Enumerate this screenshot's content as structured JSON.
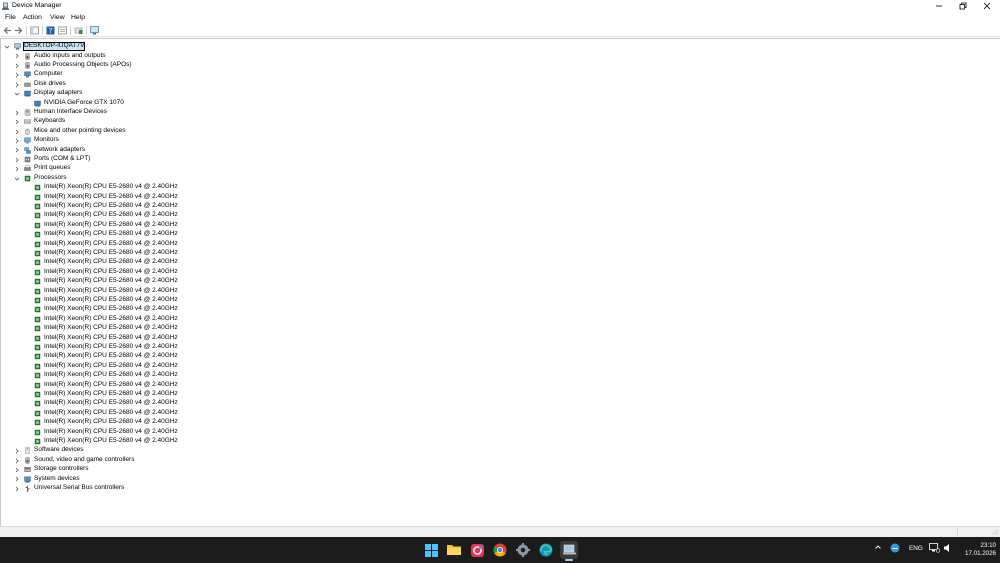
{
  "window": {
    "title": "Device Manager",
    "controls": {
      "minimize": "—",
      "restore": "❐",
      "close": "✕"
    }
  },
  "menu": [
    "File",
    "Action",
    "View",
    "Help"
  ],
  "tree": {
    "root": "DESKTOP-IUQAT7V",
    "categories": [
      {
        "label": "Audio inputs and outputs",
        "icon": "speaker-icon",
        "expanded": false
      },
      {
        "label": "Audio Processing Objects (APOs)",
        "icon": "speaker-icon",
        "expanded": false
      },
      {
        "label": "Computer",
        "icon": "computer-icon",
        "expanded": false
      },
      {
        "label": "Disk drives",
        "icon": "disk-drive-icon",
        "expanded": false
      },
      {
        "label": "Display adapters",
        "icon": "display-adapter-icon",
        "expanded": true,
        "children": [
          "NVIDIA GeForce GTX 1070"
        ]
      },
      {
        "label": "Human Interface Devices",
        "icon": "hid-icon",
        "expanded": false
      },
      {
        "label": "Keyboards",
        "icon": "keyboard-icon",
        "expanded": false
      },
      {
        "label": "Mice and other pointing devices",
        "icon": "mouse-icon",
        "expanded": false
      },
      {
        "label": "Monitors",
        "icon": "monitor-icon",
        "expanded": false
      },
      {
        "label": "Network adapters",
        "icon": "network-icon",
        "expanded": false
      },
      {
        "label": "Ports (COM & LPT)",
        "icon": "port-icon",
        "expanded": false
      },
      {
        "label": "Print queues",
        "icon": "printer-icon",
        "expanded": false
      },
      {
        "label": "Processors",
        "icon": "processor-icon",
        "expanded": true,
        "children": [
          "Intel(R) Xeon(R) CPU E5-2680 v4 @ 2.40GHz",
          "Intel(R) Xeon(R) CPU E5-2680 v4 @ 2.40GHz",
          "Intel(R) Xeon(R) CPU E5-2680 v4 @ 2.40GHz",
          "Intel(R) Xeon(R) CPU E5-2680 v4 @ 2.40GHz",
          "Intel(R) Xeon(R) CPU E5-2680 v4 @ 2.40GHz",
          "Intel(R) Xeon(R) CPU E5-2680 v4 @ 2.40GHz",
          "Intel(R) Xeon(R) CPU E5-2680 v4 @ 2.40GHz",
          "Intel(R) Xeon(R) CPU E5-2680 v4 @ 2.40GHz",
          "Intel(R) Xeon(R) CPU E5-2680 v4 @ 2.40GHz",
          "Intel(R) Xeon(R) CPU E5-2680 v4 @ 2.40GHz",
          "Intel(R) Xeon(R) CPU E5-2680 v4 @ 2.40GHz",
          "Intel(R) Xeon(R) CPU E5-2680 v4 @ 2.40GHz",
          "Intel(R) Xeon(R) CPU E5-2680 v4 @ 2.40GHz",
          "Intel(R) Xeon(R) CPU E5-2680 v4 @ 2.40GHz",
          "Intel(R) Xeon(R) CPU E5-2680 v4 @ 2.40GHz",
          "Intel(R) Xeon(R) CPU E5-2680 v4 @ 2.40GHz",
          "Intel(R) Xeon(R) CPU E5-2680 v4 @ 2.40GHz",
          "Intel(R) Xeon(R) CPU E5-2680 v4 @ 2.40GHz",
          "Intel(R) Xeon(R) CPU E5-2680 v4 @ 2.40GHz",
          "Intel(R) Xeon(R) CPU E5-2680 v4 @ 2.40GHz",
          "Intel(R) Xeon(R) CPU E5-2680 v4 @ 2.40GHz",
          "Intel(R) Xeon(R) CPU E5-2680 v4 @ 2.40GHz",
          "Intel(R) Xeon(R) CPU E5-2680 v4 @ 2.40GHz",
          "Intel(R) Xeon(R) CPU E5-2680 v4 @ 2.40GHz",
          "Intel(R) Xeon(R) CPU E5-2680 v4 @ 2.40GHz",
          "Intel(R) Xeon(R) CPU E5-2680 v4 @ 2.40GHz",
          "Intel(R) Xeon(R) CPU E5-2680 v4 @ 2.40GHz",
          "Intel(R) Xeon(R) CPU E5-2680 v4 @ 2.40GHz"
        ]
      },
      {
        "label": "Software devices",
        "icon": "software-icon",
        "expanded": false
      },
      {
        "label": "Sound, video and game controllers",
        "icon": "speaker-icon",
        "expanded": false
      },
      {
        "label": "Storage controllers",
        "icon": "storage-icon",
        "expanded": false
      },
      {
        "label": "System devices",
        "icon": "system-icon",
        "expanded": false
      },
      {
        "label": "Universal Serial Bus controllers",
        "icon": "usb-icon",
        "expanded": false
      }
    ]
  },
  "taskbar": {
    "apps": [
      "start-icon",
      "file-explorer-icon",
      "app-icon",
      "chrome-icon",
      "settings-icon",
      "edge-icon",
      "device-manager-icon"
    ],
    "tray": {
      "language": "ENG",
      "time": "23:10",
      "date": "17.01.2026"
    }
  },
  "colors": {
    "selection": "#cce4f7",
    "taskbar": "#1c1c1c",
    "accent": "#0078d4"
  }
}
